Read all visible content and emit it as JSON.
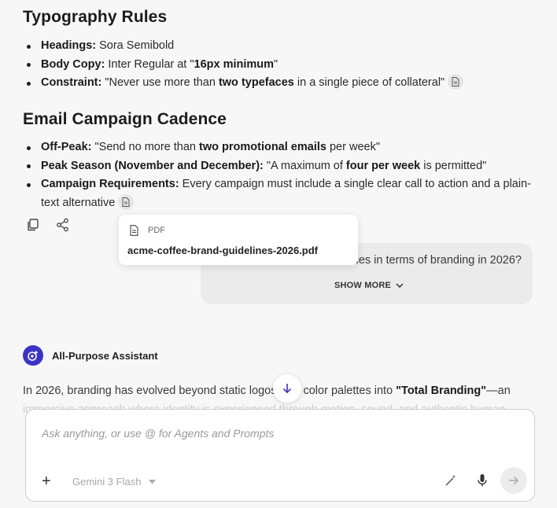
{
  "typography": {
    "heading": "Typography Rules",
    "items": [
      {
        "label": "Headings:",
        "parts": [
          " Sora Semibold"
        ]
      },
      {
        "label": "Body Copy:",
        "pre": " Inter Regular at \"",
        "bold": "16px minimum",
        "post": "\""
      },
      {
        "label": "Constraint:",
        "pre": " \"Never use more than ",
        "bold": "two typefaces",
        "post": " in a single piece of collateral\""
      }
    ]
  },
  "email": {
    "heading": "Email Campaign Cadence",
    "items": [
      {
        "label": "Off-Peak:",
        "pre": " \"Send no more than ",
        "bold": "two promotional emails",
        "post": " per week\""
      },
      {
        "label": "Peak Season (November and December):",
        "pre": " \"A maximum of ",
        "bold": "four per week",
        "post": " is permitted\""
      },
      {
        "label": "Campaign Requirements:",
        "pre": " Every campaign must include a single clear call to action and a plain-text alternative"
      }
    ]
  },
  "tooltip": {
    "type": "PDF",
    "filename": "acme-coffee-brand-guidelines-2026.pdf"
  },
  "user_message": {
    "visible_text": "ces in terms of branding in 2026?",
    "show_more": "SHOW MORE"
  },
  "assistant": {
    "name": "All-Purpose Assistant",
    "answer_pre": "In 2026, branding has evolved beyond static logos",
    "answer_mid": " color palettes into ",
    "answer_bold": "\"Total Branding\"",
    "answer_post": "—an",
    "answer_fade": "immersive approach where identity is experienced through motion, sound, and authentic human"
  },
  "composer": {
    "placeholder": "Ask anything, or use @ for Agents and Prompts",
    "model": "Gemini 3 Flash"
  },
  "icons": [
    "document-icon",
    "copy-icon",
    "share-icon",
    "chevron-down-icon",
    "assistant-avatar-icon",
    "arrow-down-icon",
    "plus-icon",
    "magic-wand-icon",
    "microphone-icon",
    "send-arrow-icon"
  ]
}
